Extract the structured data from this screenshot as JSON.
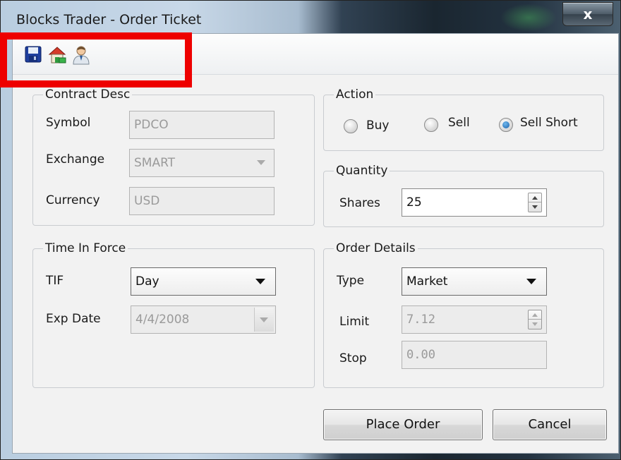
{
  "window": {
    "title": "Blocks Trader - Order Ticket",
    "close_label": "x"
  },
  "toolbar": {
    "icons": [
      "save-icon",
      "home-icon",
      "user-icon"
    ]
  },
  "contract": {
    "title": "Contract Desc",
    "symbol_label": "Symbol",
    "symbol_value": "PDCO",
    "exchange_label": "Exchange",
    "exchange_value": "SMART",
    "currency_label": "Currency",
    "currency_value": "USD"
  },
  "action": {
    "title": "Action",
    "options": [
      "Buy",
      "Sell",
      "Sell Short"
    ],
    "selected": "Sell Short"
  },
  "quantity": {
    "title": "Quantity",
    "shares_label": "Shares",
    "shares_value": "25"
  },
  "tif": {
    "title": "Time In Force",
    "tif_label": "TIF",
    "tif_value": "Day",
    "exp_label": "Exp Date",
    "exp_value": "4/4/2008"
  },
  "order": {
    "title": "Order Details",
    "type_label": "Type",
    "type_value": "Market",
    "limit_label": "Limit",
    "limit_value": "7.12",
    "stop_label": "Stop",
    "stop_value": "0.00"
  },
  "buttons": {
    "place_order": "Place Order",
    "cancel": "Cancel"
  },
  "colors": {
    "highlight": "#ee0000",
    "radio_selected": "#1a5fa8"
  }
}
